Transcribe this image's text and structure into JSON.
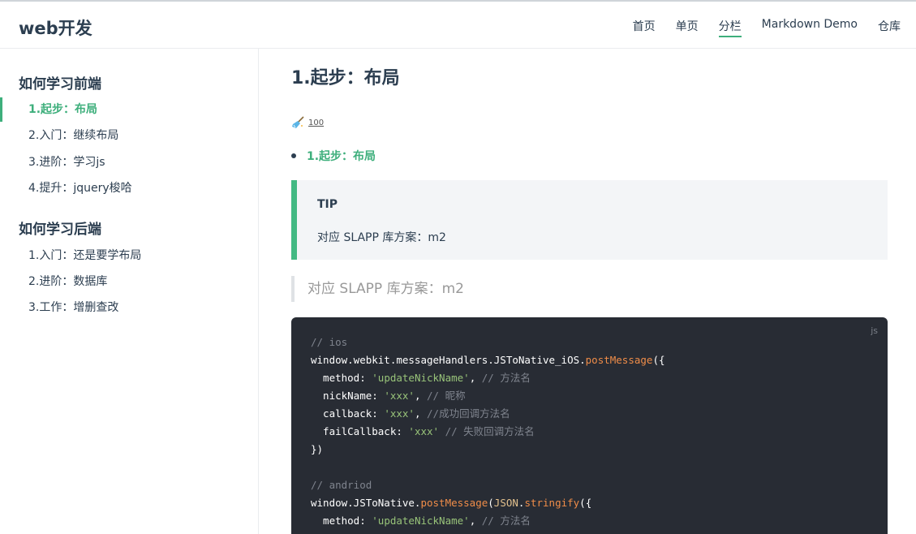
{
  "header": {
    "logo": "web开发",
    "nav": [
      {
        "label": "首页"
      },
      {
        "label": "单页"
      },
      {
        "label": "分栏",
        "active": true
      },
      {
        "label": "Markdown Demo"
      },
      {
        "label": "仓库"
      }
    ]
  },
  "sidebar": {
    "groups": [
      {
        "title": "如何学习前端",
        "items": [
          {
            "label": "1.起步：布局",
            "active": true
          },
          {
            "label": "2.入门：继续布局"
          },
          {
            "label": "3.进阶：学习js"
          },
          {
            "label": "4.提升：jquery梭哈"
          }
        ]
      },
      {
        "title": "如何学习后端",
        "items": [
          {
            "label": "1.入门：还是要学布局"
          },
          {
            "label": "2.进阶：数据库"
          },
          {
            "label": "3.工作：增删查改"
          }
        ]
      }
    ]
  },
  "main": {
    "title": "1.起步：布局",
    "badge": {
      "icon": "broom-icon",
      "text": "100"
    },
    "toc": [
      "1.起步：布局"
    ],
    "tip": {
      "title": "TIP",
      "body": "对应 SLAPP 库方案：m2"
    },
    "blockquote": "对应 SLAPP 库方案：m2",
    "code": {
      "lang": "js",
      "lines": [
        "// ios",
        "window.webkit.messageHandlers.JSToNative_iOS.postMessage({",
        "  method: 'updateNickName', // 方法名",
        "  nickName: 'xxx', // 昵称",
        "  callback: 'xxx', //成功回调方法名",
        "  failCallback: 'xxx' // 失败回调方法名",
        "})",
        "",
        "// andriod",
        "window.JSToNative.postMessage(JSON.stringify({",
        "  method: 'updateNickName', // 方法名"
      ]
    }
  },
  "colors": {
    "accent": "#3eaf7c",
    "code_bg": "#282c34",
    "tip_bg": "#f3f5f7",
    "tip_border": "#42b983"
  }
}
